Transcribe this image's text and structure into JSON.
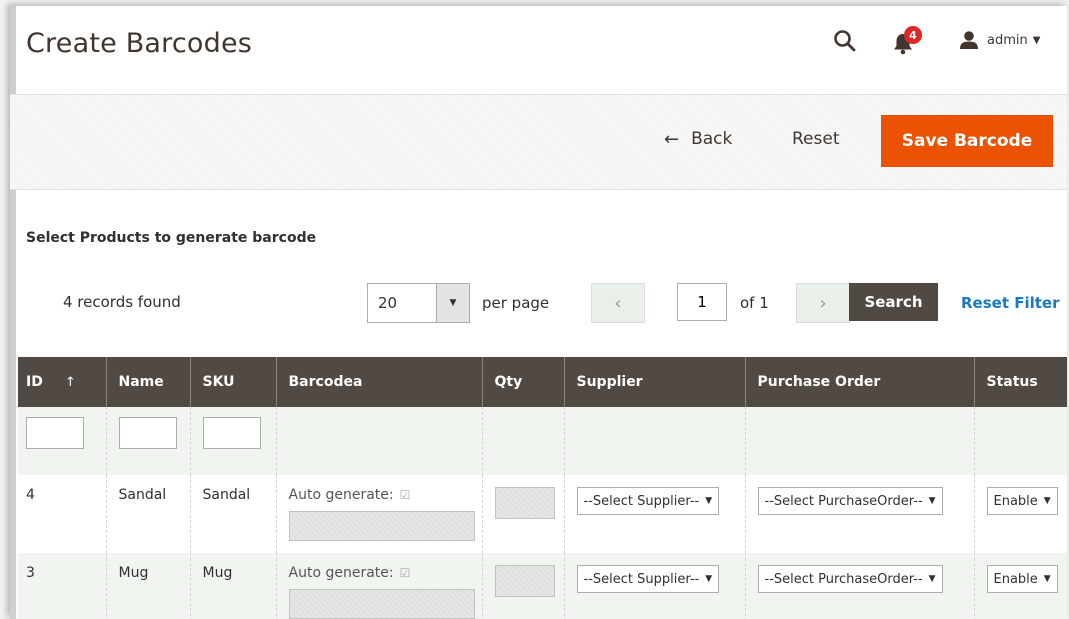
{
  "header": {
    "title": "Create Barcodes",
    "notifications_count": "4",
    "account_name": "admin"
  },
  "actions": {
    "back_label": "Back",
    "reset_label": "Reset",
    "save_label": "Save Barcode"
  },
  "section_title": "Select Products to generate barcode",
  "toolbar": {
    "records_found": "4 records found",
    "per_page_value": "20",
    "per_page_label": "per page",
    "current_page": "1",
    "page_of": "of 1",
    "search_label": "Search",
    "reset_filter_label": "Reset Filter"
  },
  "grid": {
    "columns": [
      "ID",
      "Name",
      "SKU",
      "Barcodea",
      "Qty",
      "Supplier",
      "Purchase Order",
      "Status"
    ],
    "sort_indicator": "↑",
    "rows": [
      {
        "id": "4",
        "name": "Sandal",
        "sku": "Sandal",
        "barcode_label": "Auto generate:",
        "barcode_value": "",
        "qty": "",
        "supplier": "--Select Supplier--",
        "purchase_order": "--Select PurchaseOrder--",
        "status": "Enable"
      },
      {
        "id": "3",
        "name": "Mug",
        "sku": "Mug",
        "barcode_label": "Auto generate:",
        "barcode_value": "",
        "qty": "",
        "supplier": "--Select Supplier--",
        "purchase_order": "--Select PurchaseOrder--",
        "status": "Enable"
      }
    ]
  },
  "colors": {
    "accent": "#eb5202",
    "header_dark": "#514943",
    "link": "#1979c3",
    "badge": "#e22626"
  },
  "icons": {
    "search": "search-icon",
    "notifications": "bell-icon",
    "account": "user-icon",
    "back": "arrow-left-icon",
    "caret": "caret-down-icon",
    "check": "check-icon"
  }
}
